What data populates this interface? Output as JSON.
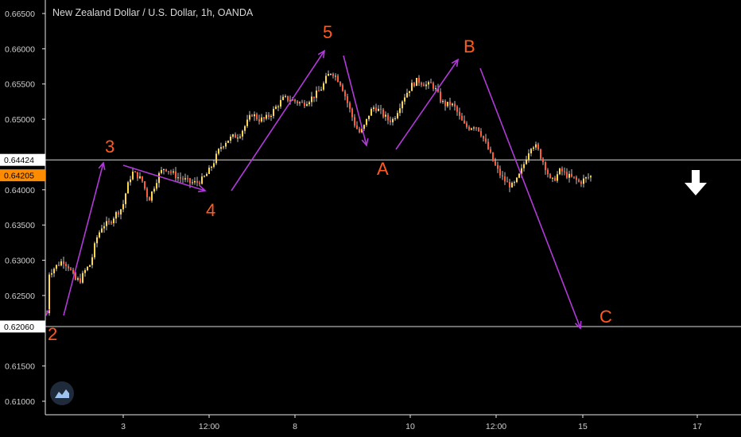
{
  "chart_data": {
    "type": "candlestick",
    "title": "New Zealand Dollar / U.S. Dollar, 1h, OANDA",
    "ylim": [
      0.608,
      0.6675
    ],
    "y_ticks": [
      "0.66500",
      "0.66000",
      "0.65500",
      "0.65000",
      "0.64000",
      "0.63500",
      "0.63000",
      "0.62500",
      "0.61500",
      "0.61000"
    ],
    "x_ticks": [
      "3",
      "12:00",
      "8",
      "10",
      "12:00",
      "15",
      "17"
    ],
    "price_labels": [
      {
        "text": "0.64424",
        "value": 0.64424,
        "bg": "#ffffff",
        "fg": "#000000"
      },
      {
        "text": "0.64205",
        "value": 0.64205,
        "bg": "#ff8c00",
        "fg": "#000000"
      },
      {
        "text": "0.62060",
        "value": 0.6206,
        "bg": "#ffffff",
        "fg": "#000000"
      }
    ],
    "horizontal_lines": [
      0.64424,
      0.6206
    ],
    "wave_labels": [
      "2",
      "3",
      "4",
      "5",
      "A",
      "B",
      "C"
    ],
    "close_path": [
      [
        0,
        0.6225
      ],
      [
        3,
        0.6282
      ],
      [
        12,
        0.6292
      ],
      [
        20,
        0.63
      ],
      [
        28,
        0.629
      ],
      [
        35,
        0.6272
      ],
      [
        42,
        0.6272
      ],
      [
        48,
        0.6285
      ],
      [
        55,
        0.6295
      ],
      [
        62,
        0.633
      ],
      [
        70,
        0.635
      ],
      [
        78,
        0.6352
      ],
      [
        86,
        0.6365
      ],
      [
        95,
        0.6375
      ],
      [
        100,
        0.64
      ],
      [
        107,
        0.6425
      ],
      [
        114,
        0.642
      ],
      [
        120,
        0.6412
      ],
      [
        128,
        0.6385
      ],
      [
        135,
        0.6405
      ],
      [
        140,
        0.642
      ],
      [
        148,
        0.6432
      ],
      [
        156,
        0.6425
      ],
      [
        164,
        0.6418
      ],
      [
        172,
        0.6415
      ],
      [
        180,
        0.641
      ],
      [
        188,
        0.641
      ],
      [
        196,
        0.6415
      ],
      [
        203,
        0.6425
      ],
      [
        210,
        0.644
      ],
      [
        218,
        0.646
      ],
      [
        226,
        0.647
      ],
      [
        234,
        0.6475
      ],
      [
        242,
        0.6478
      ],
      [
        250,
        0.6492
      ],
      [
        258,
        0.6508
      ],
      [
        266,
        0.65
      ],
      [
        274,
        0.65
      ],
      [
        282,
        0.6508
      ],
      [
        290,
        0.652
      ],
      [
        298,
        0.653
      ],
      [
        306,
        0.6528
      ],
      [
        314,
        0.6525
      ],
      [
        322,
        0.6522
      ],
      [
        330,
        0.6528
      ],
      [
        338,
        0.6535
      ],
      [
        346,
        0.6545
      ],
      [
        352,
        0.656
      ],
      [
        358,
        0.6568
      ],
      [
        364,
        0.656
      ],
      [
        370,
        0.655
      ],
      [
        376,
        0.653
      ],
      [
        382,
        0.651
      ],
      [
        388,
        0.649
      ],
      [
        394,
        0.648
      ],
      [
        400,
        0.6492
      ],
      [
        406,
        0.651
      ],
      [
        412,
        0.6518
      ],
      [
        418,
        0.6512
      ],
      [
        424,
        0.6505
      ],
      [
        430,
        0.6498
      ],
      [
        436,
        0.65
      ],
      [
        442,
        0.6515
      ],
      [
        448,
        0.653
      ],
      [
        454,
        0.654
      ],
      [
        460,
        0.655
      ],
      [
        466,
        0.6555
      ],
      [
        472,
        0.6552
      ],
      [
        478,
        0.6548
      ],
      [
        484,
        0.655
      ],
      [
        490,
        0.654
      ],
      [
        496,
        0.6525
      ],
      [
        502,
        0.652
      ],
      [
        508,
        0.6522
      ],
      [
        514,
        0.6515
      ],
      [
        520,
        0.65
      ],
      [
        526,
        0.649
      ],
      [
        532,
        0.6488
      ],
      [
        538,
        0.6492
      ],
      [
        544,
        0.6485
      ],
      [
        550,
        0.647
      ],
      [
        556,
        0.6455
      ],
      [
        562,
        0.6438
      ],
      [
        568,
        0.6425
      ],
      [
        574,
        0.6415
      ],
      [
        580,
        0.6408
      ],
      [
        586,
        0.6405
      ],
      [
        592,
        0.6415
      ],
      [
        598,
        0.643
      ],
      [
        604,
        0.645
      ],
      [
        610,
        0.6465
      ],
      [
        616,
        0.646
      ],
      [
        622,
        0.6445
      ],
      [
        628,
        0.643
      ],
      [
        634,
        0.641
      ],
      [
        640,
        0.6418
      ],
      [
        646,
        0.6428
      ],
      [
        652,
        0.6422
      ],
      [
        658,
        0.6418
      ],
      [
        664,
        0.6415
      ],
      [
        670,
        0.641
      ],
      [
        676,
        0.6415
      ],
      [
        682,
        0.6418
      ],
      [
        686,
        0.642
      ]
    ]
  }
}
